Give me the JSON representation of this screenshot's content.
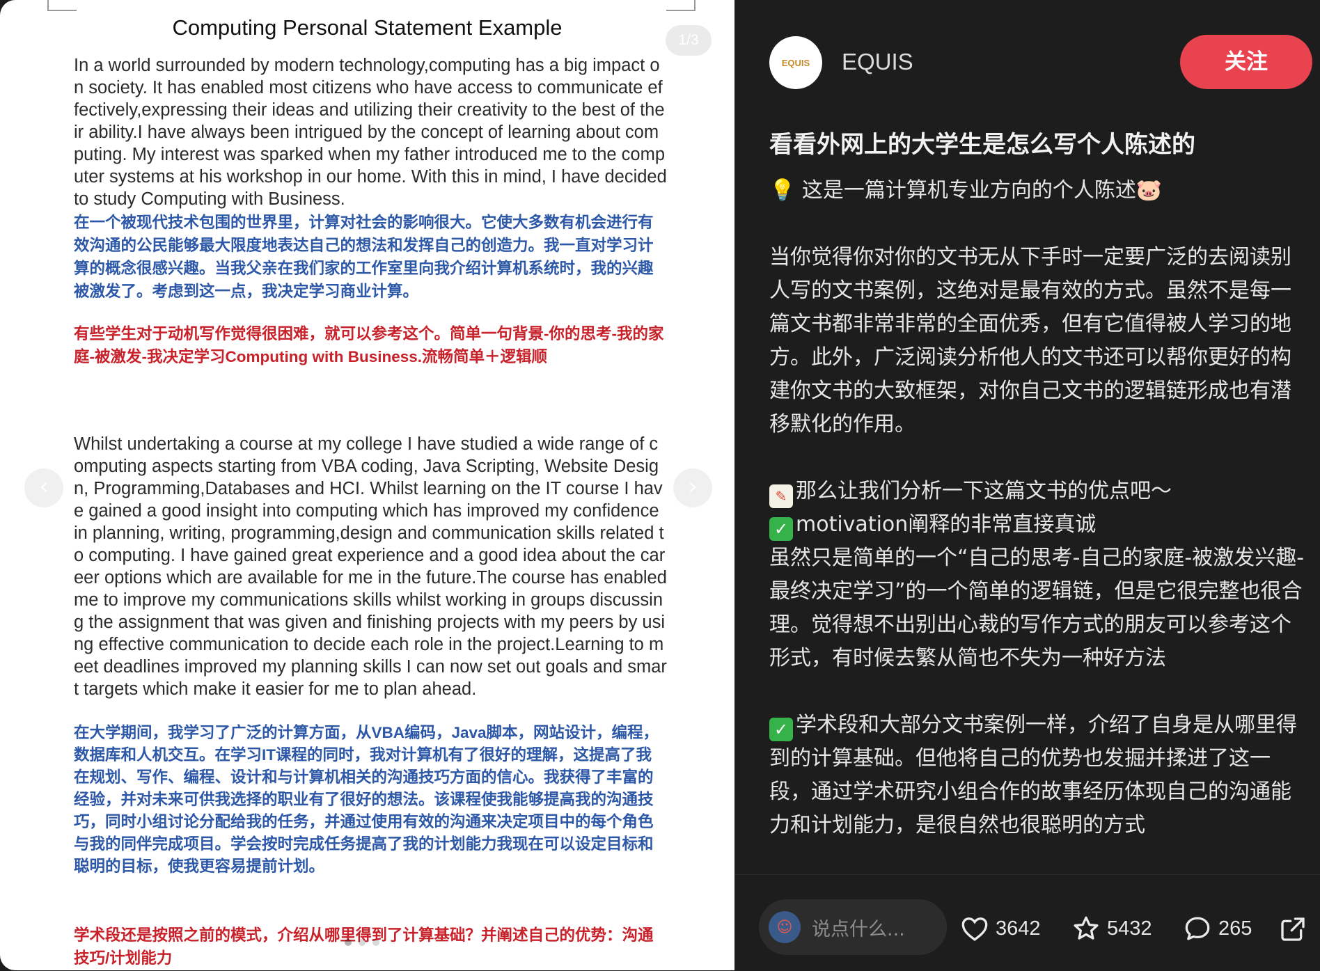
{
  "viewer": {
    "page_counter": "1/3",
    "doc_title": "Computing Personal Statement Example",
    "para1_en": "In a world surrounded by modern technology,computing has a big impact on society. It has enabled most citizens who have access to communicate effectively,expressing their ideas and utilizing their creativity to the best of their ability.I have always been intrigued by the concept of learning about computing. My interest was sparked when my father introduced me to the computer systems at his workshop in our home. With this in mind, I have decided to study Computing with Business.",
    "para1_zh": "在一个被现代技术包围的世界里，计算对社会的影响很大。它使大多数有机会进行有效沟通的公民能够最大限度地表达自己的想法和发挥自己的创造力。我一直对学习计算的概念很感兴趣。当我父亲在我们家的工作室里向我介绍计算机系统时，我的兴趣被激发了。考虑到这一点，我决定学习商业计算。",
    "note1_red": "有些学生对于动机写作觉得很困难，就可以参考这个。简单一句背景-你的思考-我的家庭-被激发-我决定学习Computing with Business.流畅简单＋逻辑顺",
    "para2_en": "Whilst undertaking a course at my college I have studied a wide range of computing aspects starting from VBA coding, Java Scripting, Website Design, Programming,Databases and HCI. Whilst learning on the IT course I have gained a good insight into computing which has improved my confidence in planning, writing, programming,design and communication skills related to computing. I have gained great experience and a good idea about the career options which are available for me in the future.The course has enabled me to improve my communications skills whilst working in groups discussing the assignment that was given and finishing projects with my peers by using effective communication to decide each role in the project.Learning to meet deadlines improved my planning skills I can now set out goals and smart targets which make it easier for me to plan ahead.",
    "para2_zh": "在大学期间，我学习了广泛的计算方面，从VBA编码，Java脚本，网站设计，编程，数据库和人机交互。在学习IT课程的同时，我对计算机有了很好的理解，这提高了我在规划、写作、编程、设计和与计算机相关的沟通技巧方面的信心。我获得了丰富的经验，并对未来可供我选择的职业有了很好的想法。该课程使我能够提高我的沟通技巧，同时小组讨论分配给我的任务，并通过使用有效的沟通来决定项目中的每个角色与我的同伴完成项目。学会按时完成任务提高了我的计划能力我现在可以设定目标和聪明的目标，使我更容易提前计划。",
    "note2_red": "学术段还是按照之前的模式，介绍从哪里得到了计算基础？并阐述自己的优势：沟通技巧/计划能力",
    "prev_icon": "chevron-left-icon",
    "next_icon": "chevron-right-icon"
  },
  "panel": {
    "avatar_text": "EQUIS",
    "author": "EQUIS",
    "follow_label": "关注",
    "title": "看看外网上的大学生是怎么写个人陈述的",
    "subtitle": "这是一篇计算机专业方向的个人陈述",
    "body_p1": "当你觉得你对你的文书无从下手时一定要广泛的去阅读别人写的文书案例，这绝对是最有效的方式。虽然不是每一篇文书都非常非常的全面优秀，但有它值得被人学习的地方。此外，广泛阅读分析他人的文书还可以帮你更好的构建你文书的大致框架，对你自己文书的逻辑链形成也有潜移默化的作用。",
    "body_p2_head": "那么让我们分析一下这篇文书的优点吧～",
    "body_p2_point": "motivation阐释的非常直接真诚",
    "body_p2_text": "虽然只是简单的一个“自己的思考-自己的家庭-被激发兴趣-最终决定学习”的一个简单的逻辑链，但是它很完整也很合理。觉得想不出别出心裁的写作方式的朋友可以参考这个形式，有时候去繁从简也不失为一种好方法",
    "body_p3": "学术段和大部分文书案例一样，介绍了自身是从哪里得到的计算基础。但他将自己的优势也发掘并揉进了这一段，通过学术研究小组合作的故事经历体现自己的沟通能力和计划能力，是很自然也很聪明的方式",
    "comment_placeholder": "说点什么...",
    "likes": "3642",
    "stars": "5432",
    "comments": "265",
    "accent": "#e8434f"
  }
}
